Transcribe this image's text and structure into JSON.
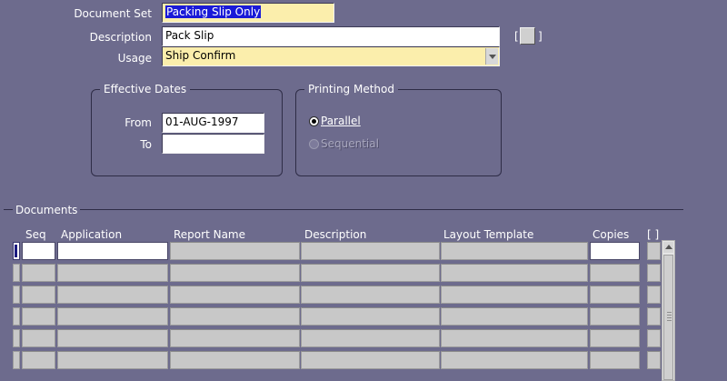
{
  "header": {
    "document_set_label": "Document Set",
    "document_set_value": "Packing Slip Only",
    "description_label": "Description",
    "description_value": "Pack Slip",
    "usage_label": "Usage",
    "usage_value": "Ship Confirm",
    "bracket_left": "[",
    "bracket_right": "]"
  },
  "effective_dates": {
    "title": "Effective Dates",
    "from_label": "From",
    "from_value": "01-AUG-1997",
    "to_label": "To",
    "to_value": ""
  },
  "printing_method": {
    "title": "Printing Method",
    "options": [
      {
        "label": "Parallel",
        "selected": true,
        "enabled": true
      },
      {
        "label": "Sequential",
        "selected": false,
        "enabled": false
      }
    ]
  },
  "documents": {
    "title": "Documents",
    "columns": [
      "Seq",
      "Application",
      "Report Name",
      "Description",
      "Layout Template",
      "Copies"
    ],
    "bracket_header": "[ ]",
    "rows": [
      {
        "seq": "",
        "application": "",
        "report_name": "",
        "description": "",
        "layout_template": "",
        "copies": ""
      },
      {
        "seq": "",
        "application": "",
        "report_name": "",
        "description": "",
        "layout_template": "",
        "copies": ""
      },
      {
        "seq": "",
        "application": "",
        "report_name": "",
        "description": "",
        "layout_template": "",
        "copies": ""
      },
      {
        "seq": "",
        "application": "",
        "report_name": "",
        "description": "",
        "layout_template": "",
        "copies": ""
      },
      {
        "seq": "",
        "application": "",
        "report_name": "",
        "description": "",
        "layout_template": "",
        "copies": ""
      },
      {
        "seq": "",
        "application": "",
        "report_name": "",
        "description": "",
        "layout_template": "",
        "copies": ""
      }
    ]
  },
  "colors": {
    "background": "#6d6b8d",
    "yellow_field": "#fbeeac",
    "selection": "#1a1ad8",
    "cell_gray": "#c8c8c8"
  },
  "icons": {
    "flex_field_button": "square-button-icon",
    "dropdown": "chevron-down-icon",
    "scroll_up": "scroll-up-arrow-icon"
  }
}
